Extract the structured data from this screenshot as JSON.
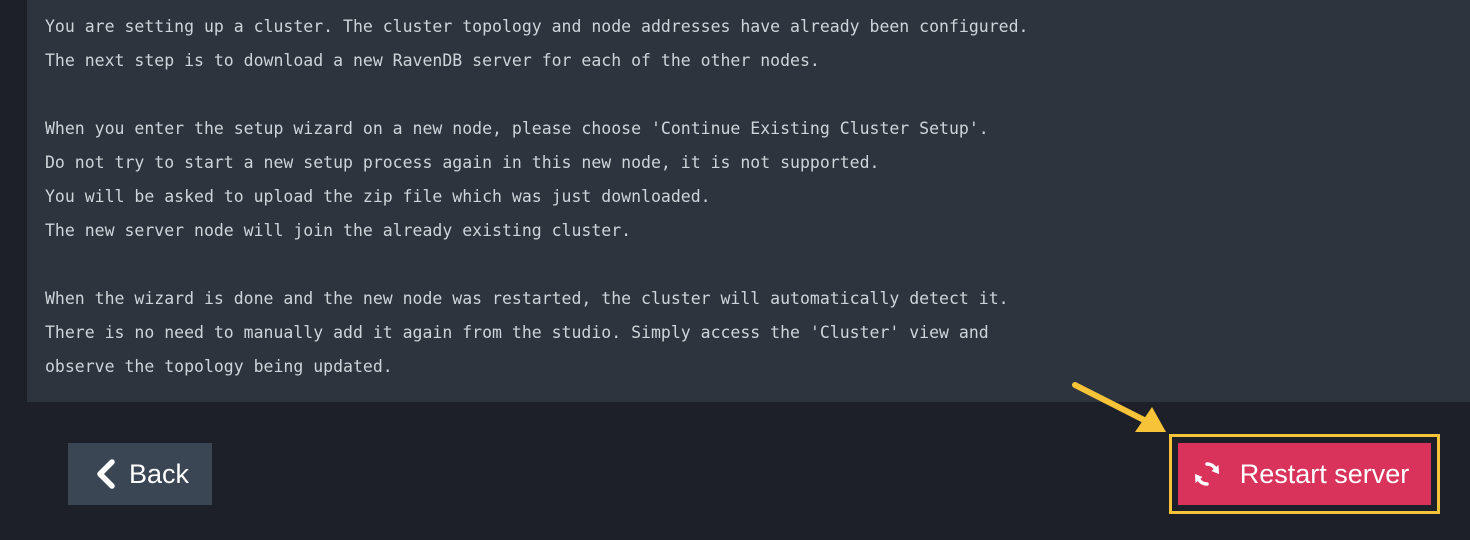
{
  "info": {
    "lines": [
      "You are setting up a cluster. The cluster topology and node addresses have already been configured.",
      "The next step is to download a new RavenDB server for each of the other nodes.",
      "",
      "When you enter the setup wizard on a new node, please choose 'Continue Existing Cluster Setup'.",
      "Do not try to start a new setup process again in this new node, it is not supported.",
      "You will be asked to upload the zip file which was just downloaded.",
      "The new server node will join the already existing cluster.",
      "",
      "When the wizard is done and the new node was restarted, the cluster will automatically detect it.",
      "There is no need to manually add it again from the studio. Simply access the 'Cluster' view and",
      "observe the topology being updated."
    ]
  },
  "actions": {
    "back_label": "Back",
    "back_icon": "chevron-left-icon",
    "restart_label": "Restart server",
    "restart_icon": "refresh-icon"
  },
  "annotation": {
    "highlight_color": "#f7c338",
    "arrow_color": "#f7c338"
  },
  "colors": {
    "page_background": "#1d2028",
    "panel_background": "#2d343d",
    "text": "#cfd4da",
    "back_button": "#3b4654",
    "restart_button": "#d9335c"
  }
}
